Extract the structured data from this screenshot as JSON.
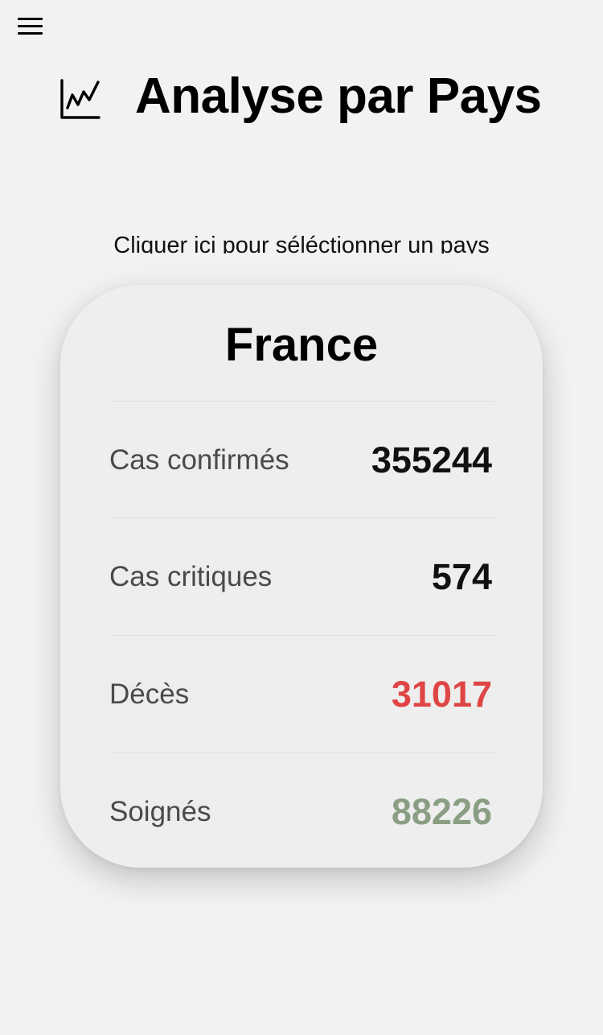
{
  "header": {
    "title": "Analyse par Pays",
    "icon": "line-chart-icon",
    "menu_icon": "hamburger-menu-icon"
  },
  "selector": {
    "label": "Cliquer ici pour séléctionner un pays"
  },
  "card": {
    "country": "France",
    "stats": [
      {
        "label": "Cas confirmés",
        "value": "355244",
        "color": "#111111"
      },
      {
        "label": "Cas critiques",
        "value": "574",
        "color": "#111111"
      },
      {
        "label": "Décès",
        "value": "31017",
        "color": "#e04545"
      },
      {
        "label": "Soignés",
        "value": "88226",
        "color": "#8a9e84"
      }
    ]
  }
}
